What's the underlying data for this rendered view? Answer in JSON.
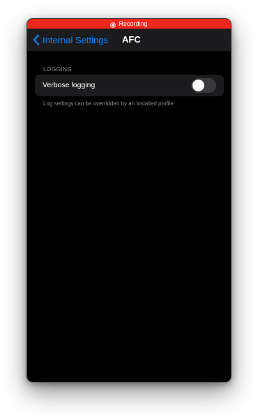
{
  "recording_bar": {
    "label": "Recording",
    "color": "#f2281d",
    "icon": "record-icon"
  },
  "navbar": {
    "back_label": "Internal Settings",
    "back_icon": "chevron-left-icon",
    "title": "AFC",
    "accent_color": "#0a84ff"
  },
  "sections": [
    {
      "header": "LOGGING",
      "rows": [
        {
          "label": "Verbose logging",
          "toggle_on": false
        }
      ],
      "footer": "Log settings can be overridden by an installed profile"
    }
  ]
}
